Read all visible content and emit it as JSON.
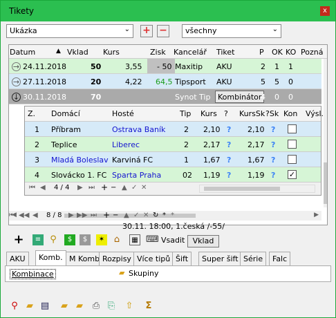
{
  "window": {
    "title": "Tikety",
    "close_label": "x"
  },
  "filters": {
    "left_select": "Ukázka",
    "plus": "+",
    "minus": "−",
    "right_select": "všechny"
  },
  "grid": {
    "headers": [
      "Datum",
      "Vklad",
      "Kurs",
      "Zisk",
      "Kancelář",
      "Tiket",
      "P",
      "OK",
      "KO",
      "Pozná"
    ],
    "rows": [
      {
        "icon": "→",
        "datum": "24.11.2018",
        "vklad": "50",
        "kurs": "3,55",
        "zisk": "- 50",
        "kancelar": "Maxitip",
        "tiket": "AKU",
        "p": "2",
        "ok": "1",
        "ko": "1"
      },
      {
        "icon": "→",
        "datum": "27.11.2018",
        "vklad": "20",
        "kurs": "4,22",
        "zisk": "64,5",
        "kancelar": "Tipsport",
        "tiket": "AKU",
        "p": "5",
        "ok": "5",
        "ko": "0"
      },
      {
        "icon": "↓",
        "datum": "30.11.2018",
        "vklad": "70",
        "kurs": "",
        "zisk": "",
        "kancelar": "Synot Tip",
        "tiket": "Kombinátor",
        "p": "4",
        "ok": "0",
        "ko": "0"
      }
    ]
  },
  "subgrid": {
    "headers": [
      "Z.",
      "Domácí",
      "Hosté",
      "Tip",
      "Kurs",
      "?",
      "KursSk",
      "?Sk",
      "Kon",
      "Výsl."
    ],
    "rows": [
      {
        "z": "1",
        "domaci": "Příbram",
        "hoste": "Ostrava Baník",
        "tip": "2",
        "kurs": "2,10",
        "kurssk": "2,10",
        "kon": false
      },
      {
        "z": "2",
        "domaci": "Teplice",
        "hoste": "Liberec",
        "tip": "2",
        "kurs": "2,17",
        "kurssk": "2,17",
        "kon": false
      },
      {
        "z": "3",
        "domaci": "Mladá Boleslav",
        "hoste": "Karviná FC",
        "tip": "1",
        "kurs": "1,67",
        "kurssk": "1,67",
        "kon": false
      },
      {
        "z": "4",
        "domaci": "Slovácko 1. FC",
        "hoste": "Sparta Praha",
        "tip": "02",
        "kurs": "1,19",
        "kurssk": "1,19",
        "kon": true
      }
    ],
    "nav": {
      "counter": "4 / 4",
      "first": "⏮",
      "prev": "◀",
      "next": "▶",
      "last": "⏭",
      "add": "+",
      "del": "−",
      "edit": "▲",
      "post": "✓",
      "cancel": "✕"
    }
  },
  "mainnav": {
    "counter": "8 / 8",
    "first": "⏮",
    "prev2": "◀◀",
    "prev": "◀",
    "next": "▶",
    "next2": "▶▶",
    "last": "⏭",
    "add": "+",
    "del": "−",
    "edit": "▲",
    "post": "✓",
    "cancel": "✕",
    "refresh": "↻",
    "star": "*",
    "star2": "*"
  },
  "status_line": "30.11. 18:00, 1.česká /-55/",
  "toolbar": {
    "vsadit": "Vsadit",
    "vklad": "Vklad"
  },
  "tabs": [
    "AKU",
    "Komb.",
    "M Komb",
    "Rozpisy",
    "Více tipů",
    "Šift",
    "Super šift",
    "Série",
    "Falc"
  ],
  "active_tab": "Komb.",
  "tabpanel": {
    "kombinace": "Kombinace",
    "skupiny": "Skupiny"
  },
  "colors": {
    "title_bg": "#2bbf50",
    "row_green": "#d6f5d6",
    "row_blue": "#d6eaf8",
    "row_selected": "#aaaaaa",
    "link_blue": "#1414d0"
  }
}
